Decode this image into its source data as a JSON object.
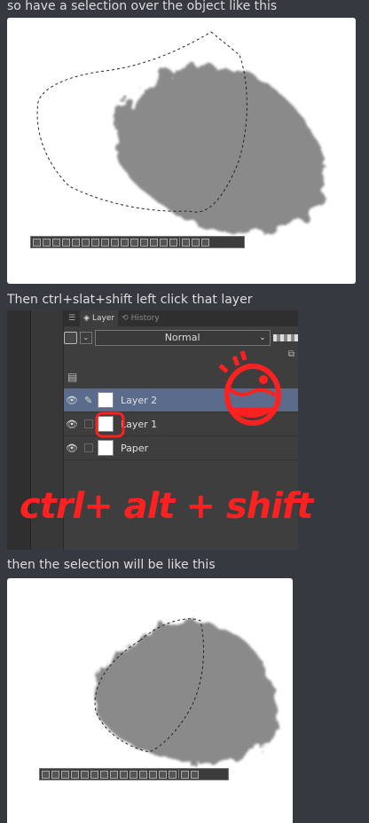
{
  "messages": [
    {
      "text": "so have a selection over the object like this"
    },
    {
      "text": "Then ctrl+slat+shift left click that layer"
    },
    {
      "text": "then the selection will be like this"
    }
  ],
  "layer_panel": {
    "tabs": [
      {
        "label": "Layer",
        "icon": "layers-icon",
        "active": true
      },
      {
        "label": "History",
        "icon": "history-icon",
        "active": false
      }
    ],
    "blend_mode": "Normal",
    "layers": [
      {
        "name": "Layer 2",
        "selected": true,
        "icon": "pen-icon"
      },
      {
        "name": "Layer 1",
        "selected": false,
        "icon": ""
      },
      {
        "name": "Paper",
        "selected": false,
        "icon": ""
      }
    ],
    "annotation_text": "ctrl+ alt + shift",
    "annotation_color": "#ff2020",
    "highlight_color": "#5a6b8c"
  },
  "colors": {
    "background": "#36393f",
    "text": "#dcddde",
    "blob": "#8a8a8a"
  }
}
